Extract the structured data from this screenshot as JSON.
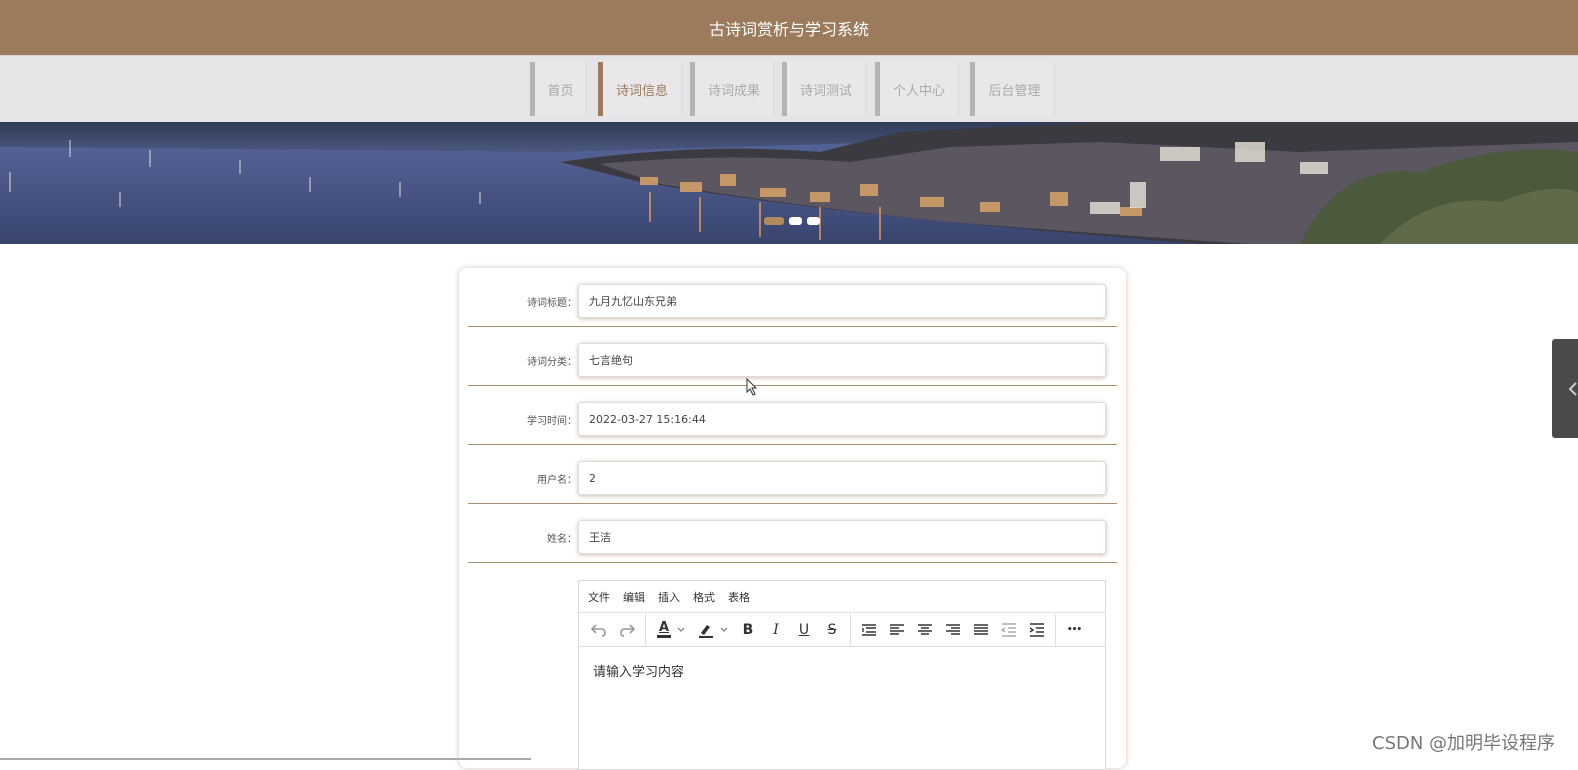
{
  "app": {
    "title": "古诗词赏析与学习系统"
  },
  "nav": {
    "items": [
      {
        "label": "首页",
        "active": false
      },
      {
        "label": "诗词信息",
        "active": true
      },
      {
        "label": "诗词成果",
        "active": false
      },
      {
        "label": "诗词测试",
        "active": false
      },
      {
        "label": "个人中心",
        "active": false
      },
      {
        "label": "后台管理",
        "active": false
      }
    ]
  },
  "banner": {
    "slide_count": 3,
    "active_slide": 1
  },
  "form": {
    "fields": [
      {
        "label": "诗词标题：",
        "value": "九月九忆山东兄弟"
      },
      {
        "label": "诗词分类：",
        "value": "七言绝句"
      },
      {
        "label": "学习时间：",
        "value": "2022-03-27 15:16:44"
      },
      {
        "label": "用户名：",
        "value": "2"
      },
      {
        "label": "姓名：",
        "value": "王洁"
      }
    ]
  },
  "editor": {
    "menu": [
      "文件",
      "编辑",
      "插入",
      "格式",
      "表格"
    ],
    "toolbar": {
      "font_color_glyph": "A",
      "bold_glyph": "B",
      "italic_glyph": "I",
      "underline_glyph": "U",
      "strike_glyph": "S",
      "more_glyph": "•••"
    },
    "content": "请输入学习内容"
  },
  "colors": {
    "brand": "#9c7b5d",
    "nav_bg": "#e6e4e6",
    "accent_dot": "#b38a5d"
  },
  "watermark": "CSDN @加明毕设程序"
}
